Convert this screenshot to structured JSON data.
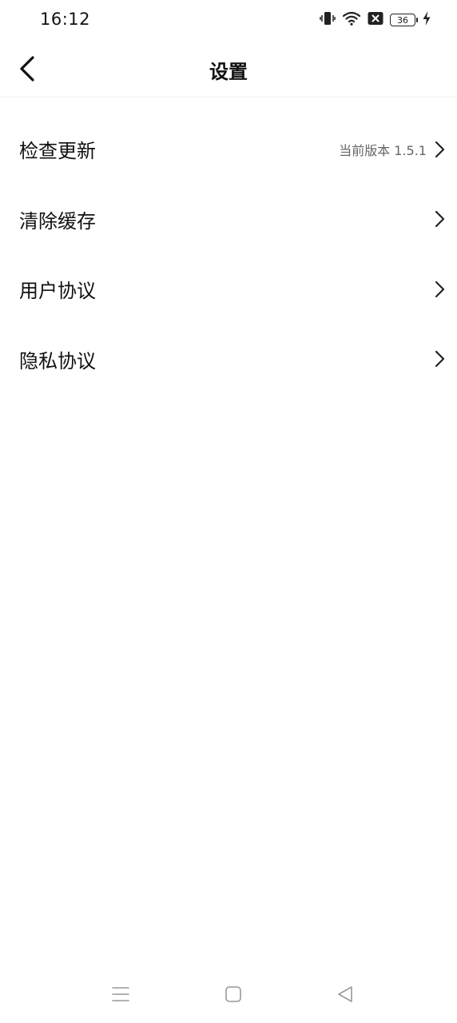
{
  "status_bar": {
    "time": "16:12",
    "battery_level": "36",
    "icons": [
      "vibrate-icon",
      "wifi-icon",
      "sim-blocked-icon",
      "battery-icon",
      "charging-icon"
    ]
  },
  "header": {
    "title": "设置",
    "back_icon": "chevron-left-icon"
  },
  "settings": {
    "items": [
      {
        "label": "检查更新",
        "value": "当前版本 1.5.1"
      },
      {
        "label": "清除缓存",
        "value": ""
      },
      {
        "label": "用户协议",
        "value": ""
      },
      {
        "label": "隐私协议",
        "value": ""
      }
    ]
  },
  "nav_bar": {
    "icons": [
      "menu-icon",
      "home-icon",
      "back-icon"
    ]
  },
  "colors": {
    "background": "#ffffff",
    "text_primary": "#111111",
    "text_secondary": "#666666",
    "divider": "#eeeeee",
    "nav_icon": "#999999"
  }
}
